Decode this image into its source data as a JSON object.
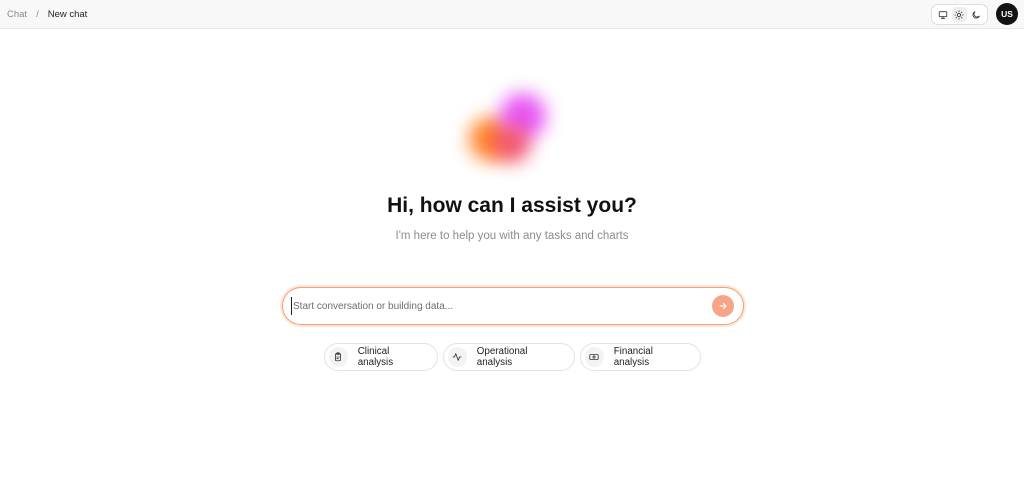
{
  "breadcrumb": {
    "parent": "Chat",
    "separator": "/",
    "current": "New chat"
  },
  "theme_toggle": {
    "options": [
      {
        "name": "system",
        "icon": "monitor-icon"
      },
      {
        "name": "light",
        "icon": "sun-icon"
      },
      {
        "name": "dark",
        "icon": "moon-icon"
      }
    ],
    "selected": "light"
  },
  "user": {
    "initials": "US"
  },
  "hero": {
    "title": "Hi, how can I assist you?",
    "subtitle": "I'm here to help you with any tasks and charts",
    "orb_colors": [
      "#e64df2",
      "#ff7e1f",
      "#f24868"
    ]
  },
  "composer": {
    "placeholder": "Start conversation or building data...",
    "value": "",
    "send_icon": "arrow-right-icon",
    "accent": "#f7a58a"
  },
  "suggestions": [
    {
      "label": "Clinical analysis",
      "icon": "clipboard-icon"
    },
    {
      "label": "Operational analysis",
      "icon": "activity-icon"
    },
    {
      "label": "Financial analysis",
      "icon": "banknote-icon"
    }
  ]
}
